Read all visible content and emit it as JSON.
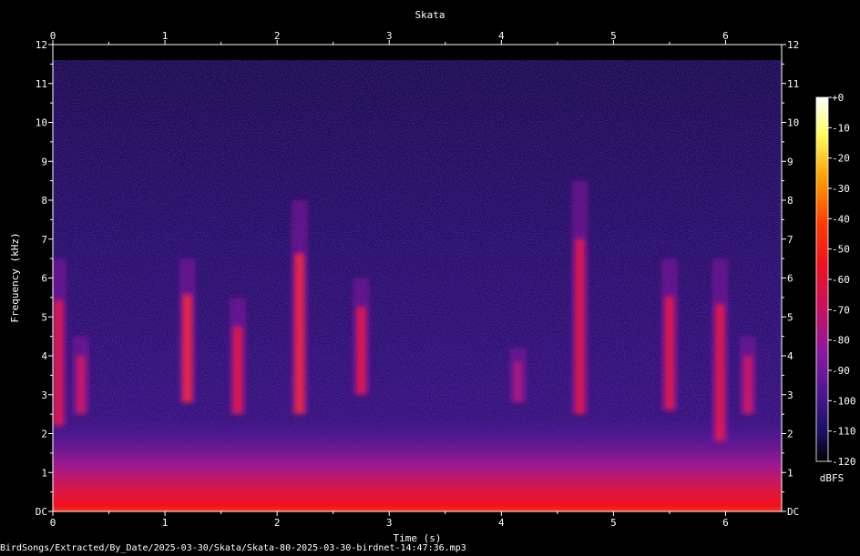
{
  "chart_data": {
    "type": "heatmap",
    "title": "Skata",
    "xlabel": "Time (s)",
    "ylabel": "Frequency (kHz)",
    "xlim": [
      0,
      6.5
    ],
    "ylim": [
      0,
      12
    ],
    "x_ticks": [
      "0",
      "1",
      "2",
      "3",
      "4",
      "5",
      "6"
    ],
    "y_ticks": [
      "DC",
      "1",
      "2",
      "3",
      "4",
      "5",
      "6",
      "7",
      "8",
      "9",
      "10",
      "11",
      "12"
    ],
    "colorbar": {
      "label": "dBFS",
      "range": [
        -120,
        0
      ],
      "ticks": [
        "+0",
        "-10",
        "-20",
        "-30",
        "-40",
        "-50",
        "-60",
        "-70",
        "-80",
        "-90",
        "-100",
        "-110",
        "-120"
      ]
    },
    "noise_ceiling_khz": 11.6,
    "calls": [
      {
        "t": 0.05,
        "f_low": 2.2,
        "f_high": 6.5,
        "level_dbfs": -55
      },
      {
        "t": 0.25,
        "f_low": 2.5,
        "f_high": 4.5,
        "level_dbfs": -60
      },
      {
        "t": 1.2,
        "f_low": 2.8,
        "f_high": 6.5,
        "level_dbfs": -50
      },
      {
        "t": 1.65,
        "f_low": 2.5,
        "f_high": 5.5,
        "level_dbfs": -55
      },
      {
        "t": 2.2,
        "f_low": 2.5,
        "f_high": 8.0,
        "level_dbfs": -50
      },
      {
        "t": 2.75,
        "f_low": 3.0,
        "f_high": 6.0,
        "level_dbfs": -55
      },
      {
        "t": 4.15,
        "f_low": 2.8,
        "f_high": 4.2,
        "level_dbfs": -65
      },
      {
        "t": 4.7,
        "f_low": 2.5,
        "f_high": 8.5,
        "level_dbfs": -55
      },
      {
        "t": 5.5,
        "f_low": 2.6,
        "f_high": 6.5,
        "level_dbfs": -52
      },
      {
        "t": 5.95,
        "f_low": 1.8,
        "f_high": 6.5,
        "level_dbfs": -55
      },
      {
        "t": 6.2,
        "f_low": 2.5,
        "f_high": 4.5,
        "level_dbfs": -60
      }
    ],
    "colors": {
      "background": "#000000",
      "axis": "#ffffff",
      "palette": [
        "#000000",
        "#1a0f55",
        "#3a1580",
        "#6a16a0",
        "#a01898",
        "#d81060",
        "#f01020",
        "#ff4400",
        "#ffa000",
        "#ffff40",
        "#ffffff"
      ]
    }
  },
  "footer": {
    "file_path": "BirdSongs/Extracted/By_Date/2025-03-30/Skata/Skata-80-2025-03-30-birdnet-14:47:36.mp3"
  }
}
